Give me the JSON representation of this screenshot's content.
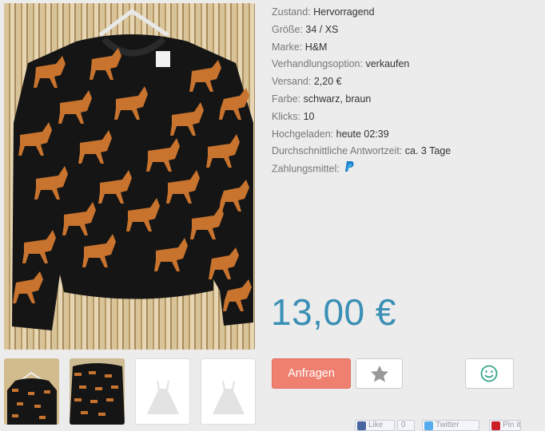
{
  "details": [
    {
      "label": "Zustand:",
      "value": "Hervorragend"
    },
    {
      "label": "Größe:",
      "value": "34 / XS"
    },
    {
      "label": "Marke:",
      "value": "H&M"
    },
    {
      "label": "Verhandlungsoption:",
      "value": "verkaufen"
    },
    {
      "label": "Versand:",
      "value": "2,20 €"
    },
    {
      "label": "Farbe:",
      "value": "schwarz, braun"
    },
    {
      "label": "Klicks:",
      "value": "10"
    },
    {
      "label": "Hochgeladen:",
      "value": "heute 02:39"
    },
    {
      "label": "Durchschnittliche Antwortzeit:",
      "value": "ca. 3 Tage"
    },
    {
      "label": "Zahlungsmittel:",
      "icon": "paypal-icon"
    }
  ],
  "price": "13,00 €",
  "actions": {
    "request_label": "Anfragen",
    "favorite_icon": "star-icon",
    "feedback_icon": "smiley-icon"
  },
  "social": {
    "like_label": "Like",
    "like_count": "0",
    "twitter_label": "Twitter",
    "pin_label": "Pin it"
  },
  "colors": {
    "price": "#3a8fb5",
    "request_button": "#ef8070",
    "paypal": "#1b7bc2"
  }
}
